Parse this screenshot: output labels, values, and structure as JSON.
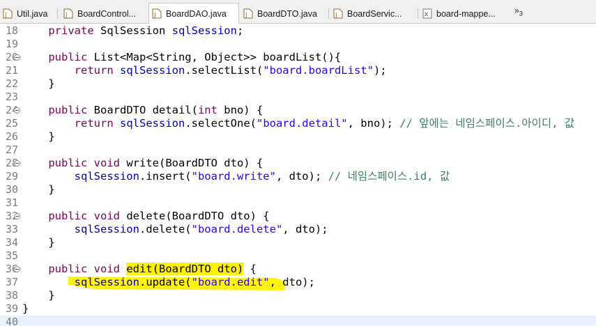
{
  "tabs": [
    {
      "label": "Util.java",
      "icon": "java-file-icon",
      "active": false
    },
    {
      "label": "BoardControl...",
      "icon": "java-file-icon",
      "active": false
    },
    {
      "label": "BoardDAO.java",
      "icon": "java-file-icon",
      "active": true
    },
    {
      "label": "BoardDTO.java",
      "icon": "java-file-icon",
      "active": false
    },
    {
      "label": "BoardServic...",
      "icon": "java-file-icon",
      "active": false
    },
    {
      "label": "board-mappe...",
      "icon": "xml-file-icon",
      "active": false
    }
  ],
  "overflow": {
    "label": "»",
    "count": "3"
  },
  "editor": {
    "lines": [
      {
        "num": "18",
        "fold": false,
        "text": "    private SqlSession sqlSession;"
      },
      {
        "num": "19",
        "fold": false,
        "text": ""
      },
      {
        "num": "20",
        "fold": true,
        "text": "    public List<Map<String, Object>> boardList(){"
      },
      {
        "num": "21",
        "fold": false,
        "text": "        return sqlSession.selectList(\"board.boardList\");"
      },
      {
        "num": "22",
        "fold": false,
        "text": "    }"
      },
      {
        "num": "23",
        "fold": false,
        "text": ""
      },
      {
        "num": "24",
        "fold": true,
        "text": "    public BoardDTO detail(int bno) {"
      },
      {
        "num": "25",
        "fold": false,
        "text": "        return sqlSession.selectOne(\"board.detail\", bno); // 앞에는 네임스페이스.아이디, 값"
      },
      {
        "num": "26",
        "fold": false,
        "text": "    }"
      },
      {
        "num": "27",
        "fold": false,
        "text": ""
      },
      {
        "num": "28",
        "fold": true,
        "text": "    public void write(BoardDTO dto) {"
      },
      {
        "num": "29",
        "fold": false,
        "text": "        sqlSession.insert(\"board.write\", dto); // 네임스페이스.id, 값"
      },
      {
        "num": "30",
        "fold": false,
        "text": "    }"
      },
      {
        "num": "31",
        "fold": false,
        "text": ""
      },
      {
        "num": "32",
        "fold": true,
        "text": "    public void delete(BoardDTO dto) {"
      },
      {
        "num": "33",
        "fold": false,
        "text": "        sqlSession.delete(\"board.delete\", dto);"
      },
      {
        "num": "34",
        "fold": false,
        "text": "    }"
      },
      {
        "num": "35",
        "fold": false,
        "text": ""
      },
      {
        "num": "36",
        "fold": true,
        "text": "    public void edit(BoardDTO dto) {"
      },
      {
        "num": "37",
        "fold": false,
        "text": "        sqlSession.update(\"board.edit\", dto);"
      },
      {
        "num": "38",
        "fold": false,
        "text": "    }"
      },
      {
        "num": "39",
        "fold": false,
        "text": "}"
      },
      {
        "num": "40",
        "fold": false,
        "text": ""
      }
    ]
  },
  "colors": {
    "keyword": "#7f0055",
    "field": "#0000c0",
    "string": "#2a00ff",
    "comment": "#3f7f5f",
    "highlight": "#fff200",
    "current_line": "#e8f2fe"
  }
}
